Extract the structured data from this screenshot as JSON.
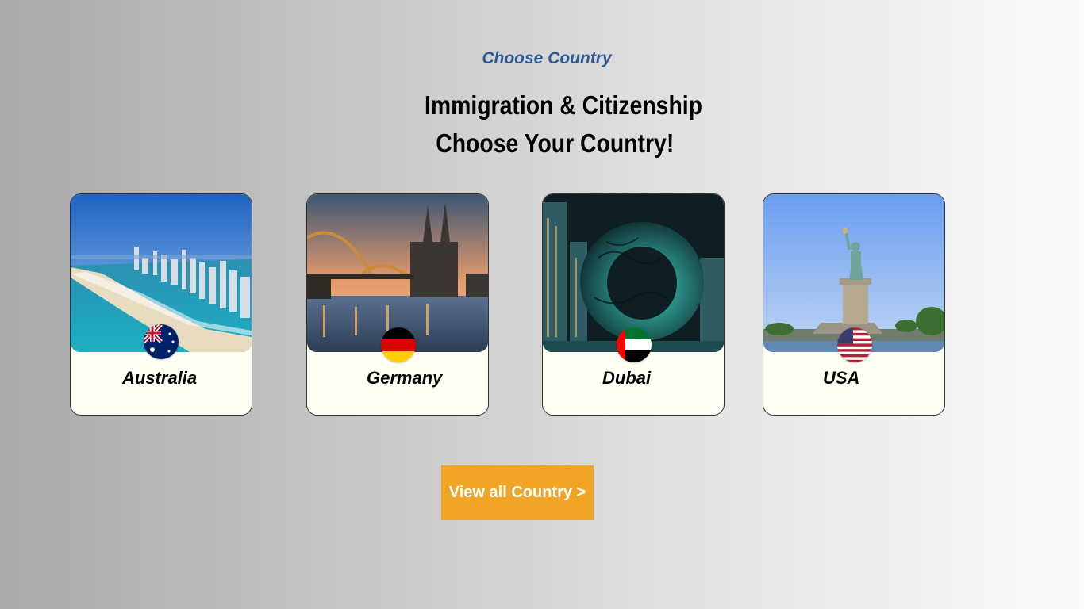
{
  "section": {
    "eyebrow": "Choose Country",
    "title_line1": "Immigration & Citizenship",
    "title_line2": "Choose Your Country!"
  },
  "countries": [
    {
      "name": "Australia",
      "flag_icon": "australia-flag-icon",
      "photo": "gold-coast-skyline-beach"
    },
    {
      "name": "Germany",
      "flag_icon": "germany-flag-icon",
      "photo": "cologne-cathedral-bridge"
    },
    {
      "name": "Dubai",
      "flag_icon": "uae-flag-icon",
      "photo": "museum-of-the-future"
    },
    {
      "name": "USA",
      "flag_icon": "usa-flag-icon",
      "photo": "statue-of-liberty"
    }
  ],
  "cta": {
    "label": "View all Country >"
  },
  "colors": {
    "eyebrow": "#2d5a97",
    "button": "#f2a424",
    "card_background": "#fffff4"
  }
}
